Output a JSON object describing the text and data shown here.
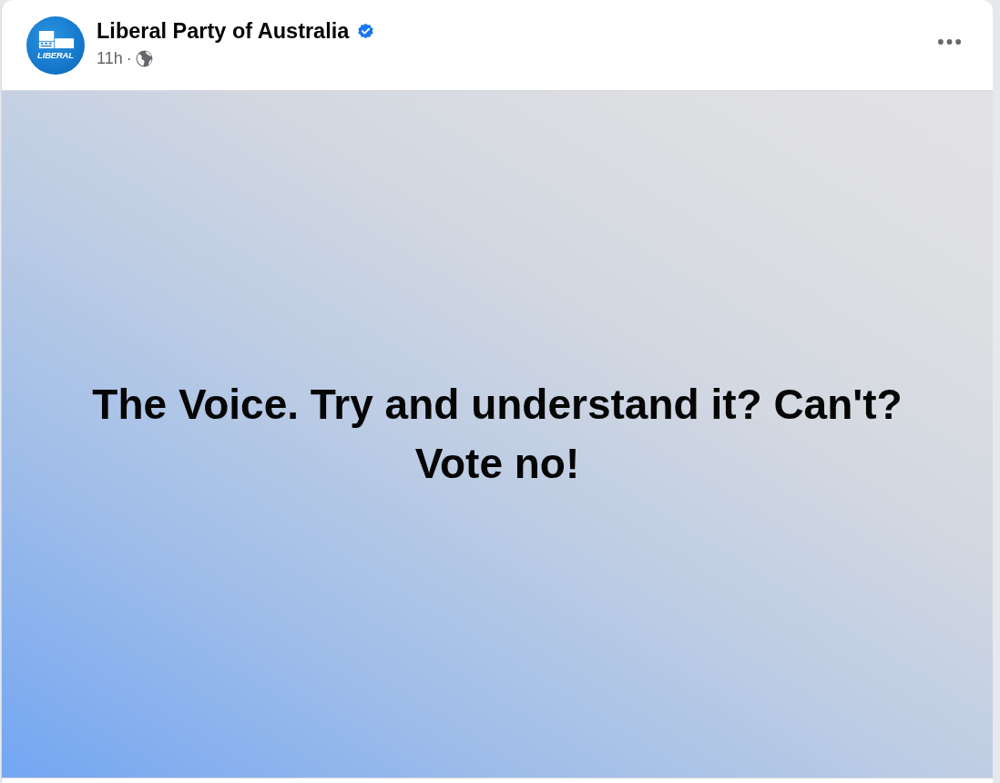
{
  "post": {
    "author": {
      "name": "Liberal Party of Australia",
      "verified": true,
      "avatar_text": "LIBERAL"
    },
    "meta": {
      "time": "11h",
      "separator": "·"
    },
    "body": {
      "kind": "text_background",
      "text": "The Voice. Try and understand it? Can't? Vote no!"
    }
  }
}
